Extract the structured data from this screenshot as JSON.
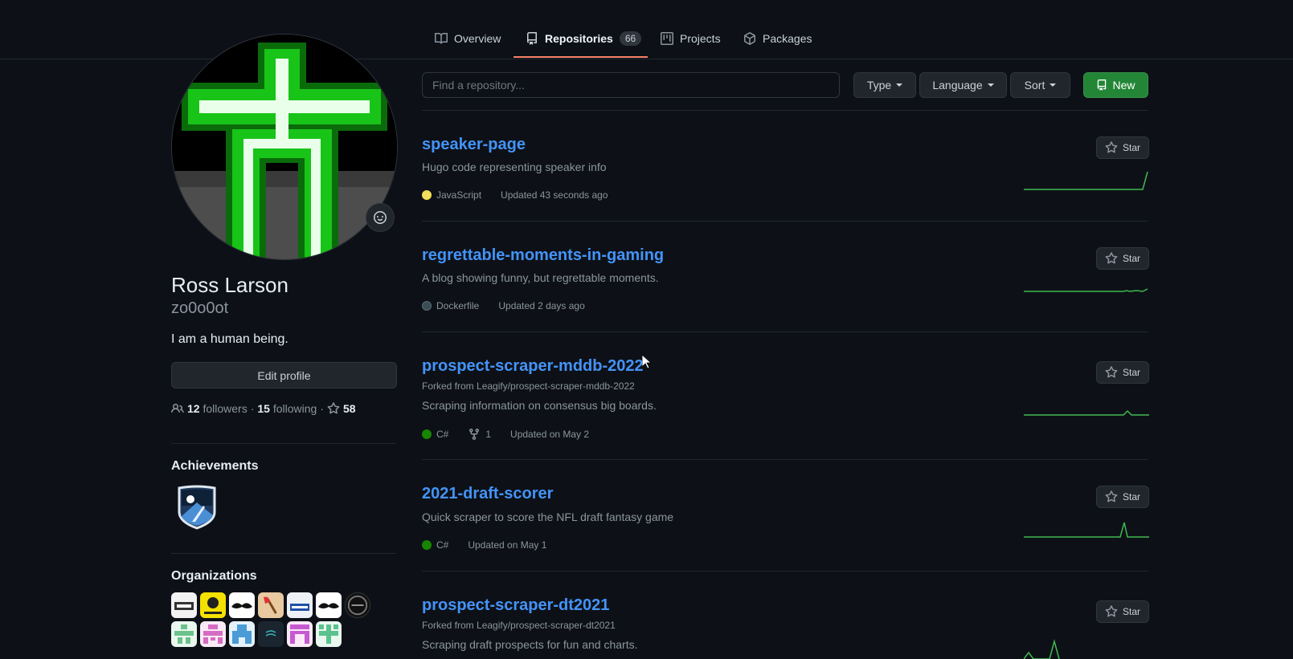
{
  "nav": {
    "tabs": [
      {
        "label": "Overview",
        "icon": "book-icon"
      },
      {
        "label": "Repositories",
        "icon": "repo-icon",
        "count": "66"
      },
      {
        "label": "Projects",
        "icon": "project-icon"
      },
      {
        "label": "Packages",
        "icon": "package-icon"
      }
    ],
    "active_tab": "Repositories"
  },
  "profile": {
    "full_name": "Ross Larson",
    "username": "zo0o0ot",
    "bio": "I am a human being.",
    "edit_label": "Edit profile",
    "followers_count": "12",
    "followers_label": "followers",
    "following_count": "15",
    "following_label": "following",
    "stars_count": "58",
    "sep": "·"
  },
  "achievements": {
    "title": "Achievements"
  },
  "organizations": {
    "title": "Organizations"
  },
  "toolbar": {
    "search_placeholder": "Find a repository...",
    "type_label": "Type",
    "language_label": "Language",
    "sort_label": "Sort",
    "new_label": "New"
  },
  "star_label": "Star",
  "repos": [
    {
      "name": "speaker-page",
      "description": "Hugo code representing speaker info",
      "language": "JavaScript",
      "language_color": "#f1e05a",
      "updated": "Updated 43 seconds ago"
    },
    {
      "name": "regrettable-moments-in-gaming",
      "description": "A blog showing funny, but regrettable moments.",
      "language": "Dockerfile",
      "language_color": "#384d54",
      "updated": "Updated 2 days ago"
    },
    {
      "name": "prospect-scraper-mddb-2022",
      "forked_from": "Forked from Leagify/prospect-scraper-mddb-2022",
      "description": "Scraping information on consensus big boards.",
      "language": "C#",
      "language_color": "#178600",
      "forks": "1",
      "updated": "Updated on May 2"
    },
    {
      "name": "2021-draft-scorer",
      "description": "Quick scraper to score the NFL draft fantasy game",
      "language": "C#",
      "language_color": "#178600",
      "updated": "Updated on May 1"
    },
    {
      "name": "prospect-scraper-dt2021",
      "forked_from": "Forked from Leagify/prospect-scraper-dt2021",
      "description": "Scraping draft prospects for fun and charts."
    }
  ],
  "colors": {
    "accent_link": "#4493f8",
    "tab_underline": "#f78166",
    "new_button": "#238636",
    "sparkline": "#3fb950"
  }
}
